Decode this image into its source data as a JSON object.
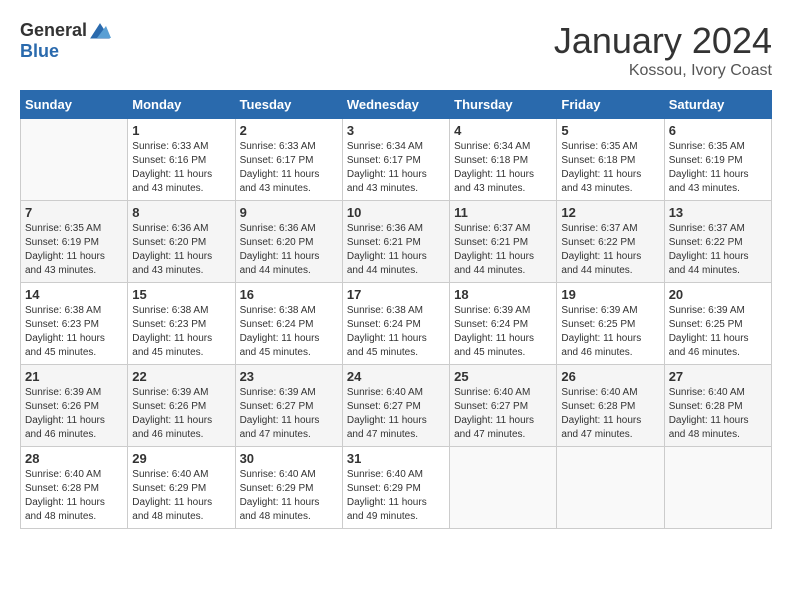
{
  "header": {
    "logo_general": "General",
    "logo_blue": "Blue",
    "month": "January 2024",
    "location": "Kossou, Ivory Coast"
  },
  "weekdays": [
    "Sunday",
    "Monday",
    "Tuesday",
    "Wednesday",
    "Thursday",
    "Friday",
    "Saturday"
  ],
  "weeks": [
    [
      {
        "day": "",
        "sunrise": "",
        "sunset": "",
        "daylight": ""
      },
      {
        "day": "1",
        "sunrise": "Sunrise: 6:33 AM",
        "sunset": "Sunset: 6:16 PM",
        "daylight": "Daylight: 11 hours and 43 minutes."
      },
      {
        "day": "2",
        "sunrise": "Sunrise: 6:33 AM",
        "sunset": "Sunset: 6:17 PM",
        "daylight": "Daylight: 11 hours and 43 minutes."
      },
      {
        "day": "3",
        "sunrise": "Sunrise: 6:34 AM",
        "sunset": "Sunset: 6:17 PM",
        "daylight": "Daylight: 11 hours and 43 minutes."
      },
      {
        "day": "4",
        "sunrise": "Sunrise: 6:34 AM",
        "sunset": "Sunset: 6:18 PM",
        "daylight": "Daylight: 11 hours and 43 minutes."
      },
      {
        "day": "5",
        "sunrise": "Sunrise: 6:35 AM",
        "sunset": "Sunset: 6:18 PM",
        "daylight": "Daylight: 11 hours and 43 minutes."
      },
      {
        "day": "6",
        "sunrise": "Sunrise: 6:35 AM",
        "sunset": "Sunset: 6:19 PM",
        "daylight": "Daylight: 11 hours and 43 minutes."
      }
    ],
    [
      {
        "day": "7",
        "sunrise": "Sunrise: 6:35 AM",
        "sunset": "Sunset: 6:19 PM",
        "daylight": "Daylight: 11 hours and 43 minutes."
      },
      {
        "day": "8",
        "sunrise": "Sunrise: 6:36 AM",
        "sunset": "Sunset: 6:20 PM",
        "daylight": "Daylight: 11 hours and 43 minutes."
      },
      {
        "day": "9",
        "sunrise": "Sunrise: 6:36 AM",
        "sunset": "Sunset: 6:20 PM",
        "daylight": "Daylight: 11 hours and 44 minutes."
      },
      {
        "day": "10",
        "sunrise": "Sunrise: 6:36 AM",
        "sunset": "Sunset: 6:21 PM",
        "daylight": "Daylight: 11 hours and 44 minutes."
      },
      {
        "day": "11",
        "sunrise": "Sunrise: 6:37 AM",
        "sunset": "Sunset: 6:21 PM",
        "daylight": "Daylight: 11 hours and 44 minutes."
      },
      {
        "day": "12",
        "sunrise": "Sunrise: 6:37 AM",
        "sunset": "Sunset: 6:22 PM",
        "daylight": "Daylight: 11 hours and 44 minutes."
      },
      {
        "day": "13",
        "sunrise": "Sunrise: 6:37 AM",
        "sunset": "Sunset: 6:22 PM",
        "daylight": "Daylight: 11 hours and 44 minutes."
      }
    ],
    [
      {
        "day": "14",
        "sunrise": "Sunrise: 6:38 AM",
        "sunset": "Sunset: 6:23 PM",
        "daylight": "Daylight: 11 hours and 45 minutes."
      },
      {
        "day": "15",
        "sunrise": "Sunrise: 6:38 AM",
        "sunset": "Sunset: 6:23 PM",
        "daylight": "Daylight: 11 hours and 45 minutes."
      },
      {
        "day": "16",
        "sunrise": "Sunrise: 6:38 AM",
        "sunset": "Sunset: 6:24 PM",
        "daylight": "Daylight: 11 hours and 45 minutes."
      },
      {
        "day": "17",
        "sunrise": "Sunrise: 6:38 AM",
        "sunset": "Sunset: 6:24 PM",
        "daylight": "Daylight: 11 hours and 45 minutes."
      },
      {
        "day": "18",
        "sunrise": "Sunrise: 6:39 AM",
        "sunset": "Sunset: 6:24 PM",
        "daylight": "Daylight: 11 hours and 45 minutes."
      },
      {
        "day": "19",
        "sunrise": "Sunrise: 6:39 AM",
        "sunset": "Sunset: 6:25 PM",
        "daylight": "Daylight: 11 hours and 46 minutes."
      },
      {
        "day": "20",
        "sunrise": "Sunrise: 6:39 AM",
        "sunset": "Sunset: 6:25 PM",
        "daylight": "Daylight: 11 hours and 46 minutes."
      }
    ],
    [
      {
        "day": "21",
        "sunrise": "Sunrise: 6:39 AM",
        "sunset": "Sunset: 6:26 PM",
        "daylight": "Daylight: 11 hours and 46 minutes."
      },
      {
        "day": "22",
        "sunrise": "Sunrise: 6:39 AM",
        "sunset": "Sunset: 6:26 PM",
        "daylight": "Daylight: 11 hours and 46 minutes."
      },
      {
        "day": "23",
        "sunrise": "Sunrise: 6:39 AM",
        "sunset": "Sunset: 6:27 PM",
        "daylight": "Daylight: 11 hours and 47 minutes."
      },
      {
        "day": "24",
        "sunrise": "Sunrise: 6:40 AM",
        "sunset": "Sunset: 6:27 PM",
        "daylight": "Daylight: 11 hours and 47 minutes."
      },
      {
        "day": "25",
        "sunrise": "Sunrise: 6:40 AM",
        "sunset": "Sunset: 6:27 PM",
        "daylight": "Daylight: 11 hours and 47 minutes."
      },
      {
        "day": "26",
        "sunrise": "Sunrise: 6:40 AM",
        "sunset": "Sunset: 6:28 PM",
        "daylight": "Daylight: 11 hours and 47 minutes."
      },
      {
        "day": "27",
        "sunrise": "Sunrise: 6:40 AM",
        "sunset": "Sunset: 6:28 PM",
        "daylight": "Daylight: 11 hours and 48 minutes."
      }
    ],
    [
      {
        "day": "28",
        "sunrise": "Sunrise: 6:40 AM",
        "sunset": "Sunset: 6:28 PM",
        "daylight": "Daylight: 11 hours and 48 minutes."
      },
      {
        "day": "29",
        "sunrise": "Sunrise: 6:40 AM",
        "sunset": "Sunset: 6:29 PM",
        "daylight": "Daylight: 11 hours and 48 minutes."
      },
      {
        "day": "30",
        "sunrise": "Sunrise: 6:40 AM",
        "sunset": "Sunset: 6:29 PM",
        "daylight": "Daylight: 11 hours and 48 minutes."
      },
      {
        "day": "31",
        "sunrise": "Sunrise: 6:40 AM",
        "sunset": "Sunset: 6:29 PM",
        "daylight": "Daylight: 11 hours and 49 minutes."
      },
      {
        "day": "",
        "sunrise": "",
        "sunset": "",
        "daylight": ""
      },
      {
        "day": "",
        "sunrise": "",
        "sunset": "",
        "daylight": ""
      },
      {
        "day": "",
        "sunrise": "",
        "sunset": "",
        "daylight": ""
      }
    ]
  ]
}
